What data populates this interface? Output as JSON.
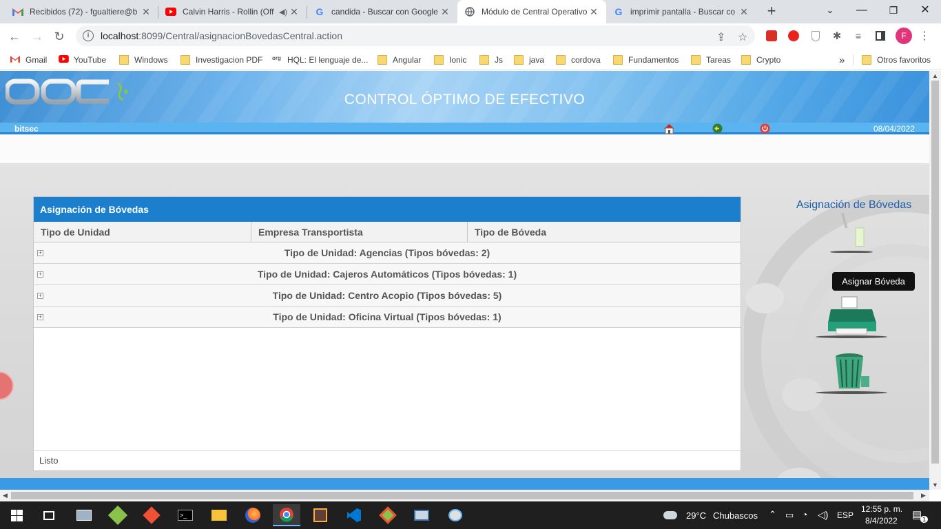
{
  "browser": {
    "tabs": [
      {
        "title": "Recibidos (72) - fgualtiere@b",
        "icon": "gmail-icon"
      },
      {
        "title": "Calvin Harris - Rollin (Off",
        "icon": "youtube-icon",
        "audio": true
      },
      {
        "title": "candida - Buscar con Google",
        "icon": "google-icon"
      },
      {
        "title": "Módulo de Central Operativo",
        "icon": "globe-icon",
        "active": true
      },
      {
        "title": "imprimir pantalla - Buscar co",
        "icon": "google-icon"
      }
    ],
    "url_host": "localhost",
    "url_rest": ":8099/Central/asignacionBovedasCentral.action",
    "profile_initial": "F",
    "bookmarks": [
      "Gmail",
      "YouTube",
      "Windows",
      "Investigacion PDF",
      "HQL: El lenguaje de...",
      "Angular",
      "Ionic",
      "Js",
      "java",
      "cordova",
      "Fundamentos",
      "Tareas",
      "Crypto"
    ],
    "bookmarks_overflow": "»",
    "other_bookmarks": "Otros favoritos"
  },
  "app": {
    "title": "CONTROL ÓPTIMO DE EFECTIVO",
    "user": "bitsec",
    "date": "08/04/2022",
    "grid": {
      "title": "Asignación de Bóvedas",
      "columns": [
        "Tipo de Unidad",
        "Empresa Transportista",
        "Tipo de Bóveda"
      ],
      "groups": [
        "Tipo de Unidad: Agencias (Tipos bóvedas: 2)",
        "Tipo de Unidad: Cajeros Automáticos (Tipos bóvedas: 1)",
        "Tipo de Unidad: Centro Acopio (Tipos bóvedas: 5)",
        "Tipo de Unidad: Oficina Virtual (Tipos bóvedas: 1)"
      ],
      "status": "Listo"
    },
    "side_title": "Asignación de Bóvedas",
    "tooltip": "Asignar Bóveda"
  },
  "taskbar": {
    "weather_temp": "29°C",
    "weather_desc": "Chubascos",
    "lang": "ESP",
    "time": "12:55 p. m.",
    "date": "8/4/2022",
    "notifications": "1"
  },
  "colors": {
    "accent": "#1c7fce",
    "header_blue": "#3b9ae8"
  }
}
